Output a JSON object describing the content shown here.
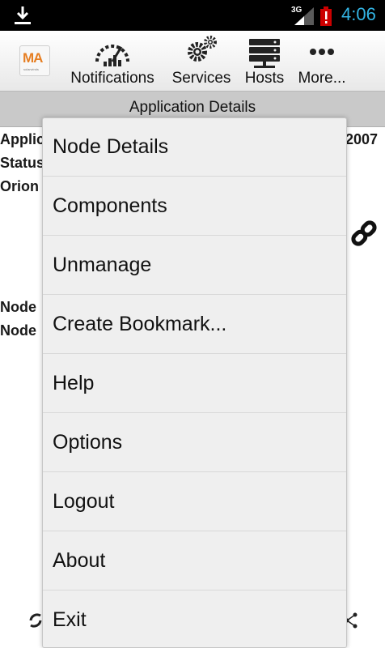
{
  "status_bar": {
    "network": "3G",
    "time": "4:06",
    "time_color": "#33b5e5",
    "icons": [
      "download-icon",
      "signal-icon",
      "battery-alert-icon"
    ]
  },
  "toolbar": {
    "logo_text": "MA",
    "logo_subtext": "solarwinds",
    "items": [
      {
        "label": "Notifications",
        "icon": "gauge-icon"
      },
      {
        "label": "Services",
        "icon": "gears-icon"
      },
      {
        "label": "Hosts",
        "icon": "server-icon"
      },
      {
        "label": "More...",
        "icon": "more-dots-icon"
      }
    ]
  },
  "title_bar": {
    "title": "Application Details"
  },
  "background": {
    "line1_left": "Applic",
    "line1_right": "2007",
    "line2": "Status",
    "line3": "Orion",
    "line4": "Node",
    "line5": "Node",
    "link_icon": "link-icon",
    "refresh_icon": "refresh-icon",
    "share_icon": "share-icon"
  },
  "menu": {
    "items": [
      "Node Details",
      "Components",
      "Unmanage",
      "Create Bookmark...",
      "Help",
      "Options",
      "Logout",
      "About",
      "Exit"
    ]
  }
}
